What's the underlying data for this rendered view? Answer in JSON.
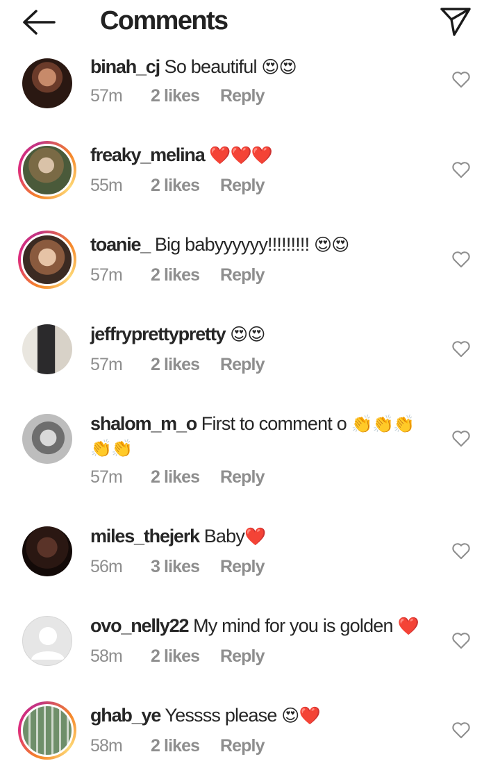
{
  "header": {
    "title": "Comments",
    "back_icon": "arrow-left-icon",
    "share_icon": "paper-plane-icon"
  },
  "colors": {
    "text": "#262626",
    "meta": "#8e8e8e",
    "heart_red": "#e0202e",
    "story_ring": [
      "#f58529",
      "#dd2a7b",
      "#c13584",
      "#feda77"
    ]
  },
  "comments": [
    {
      "username": "binah_cj",
      "text": "So beautiful",
      "emoji": "😍😍",
      "time": "57m",
      "likes": "2 likes",
      "reply": "Reply"
    },
    {
      "username": "freaky_melina",
      "text": "",
      "emoji": "❤️❤️❤️",
      "time": "55m",
      "likes": "2 likes",
      "reply": "Reply"
    },
    {
      "username": "toanie_",
      "text": "Big babyyyyyy!!!!!!!!!",
      "emoji": "😍😍",
      "time": "57m",
      "likes": "2 likes",
      "reply": "Reply"
    },
    {
      "username": "jeffryprettypretty",
      "text": "",
      "emoji": "😍😍",
      "time": "57m",
      "likes": "2 likes",
      "reply": "Reply"
    },
    {
      "username": "shalom_m_o",
      "text": "First to comment o",
      "emoji": "👏👏👏 👏👏",
      "time": "57m",
      "likes": "2 likes",
      "reply": "Reply"
    },
    {
      "username": "miles_thejerk",
      "text": "Baby",
      "emoji": "❤️",
      "time": "56m",
      "likes": "3 likes",
      "reply": "Reply"
    },
    {
      "username": "ovo_nelly22",
      "text": "My mind for you is golden",
      "emoji": "❤️",
      "time": "58m",
      "likes": "2 likes",
      "reply": "Reply"
    },
    {
      "username": "ghab_ye",
      "text": "Yessss please",
      "emoji": "😍❤️",
      "time": "58m",
      "likes": "2 likes",
      "reply": "Reply"
    }
  ]
}
